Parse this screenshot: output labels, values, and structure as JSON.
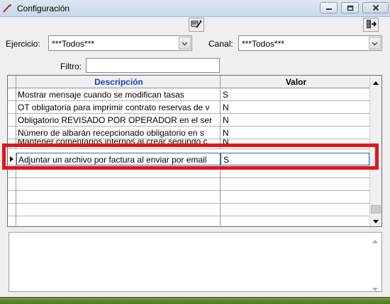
{
  "window": {
    "title": "Configuración",
    "minimize_icon": "minimize-icon",
    "maximize_icon": "maximize-icon",
    "close_icon": "close-icon"
  },
  "toolbar": {
    "edit_icon": "edit-record-icon",
    "exit_icon": "exit-door-icon"
  },
  "filters": {
    "ejercicio_label": "Ejercicio:",
    "ejercicio_value": "***Todos***",
    "canal_label": "Canal:",
    "canal_value": "***Todos***",
    "filtro_label": "Filtro:",
    "filtro_value": ""
  },
  "grid": {
    "columns": [
      "Descripción",
      "Valor"
    ],
    "rows": [
      {
        "descripcion": "Mostrar mensaje cuando se modifican tasas",
        "valor": "S"
      },
      {
        "descripcion": "OT obligatoria para imprimir contrato reservas de v",
        "valor": "N"
      },
      {
        "descripcion": "Obligatorio REVISADO POR OPERADOR en el ser",
        "valor": "N"
      },
      {
        "descripcion": "Número de albarán recepcionado obligatorio en s",
        "valor": "N"
      },
      {
        "descripcion": "Mantener comentarios internos al crear segundo c",
        "valor": "N"
      },
      {
        "descripcion": "Adjuntar un archivo por factura al enviar por email",
        "valor": "S"
      }
    ],
    "selected_index": 5
  },
  "colors": {
    "header_text": "#1e3fc2",
    "highlight": "#e4151c",
    "selection_border": "#2b6db8"
  }
}
